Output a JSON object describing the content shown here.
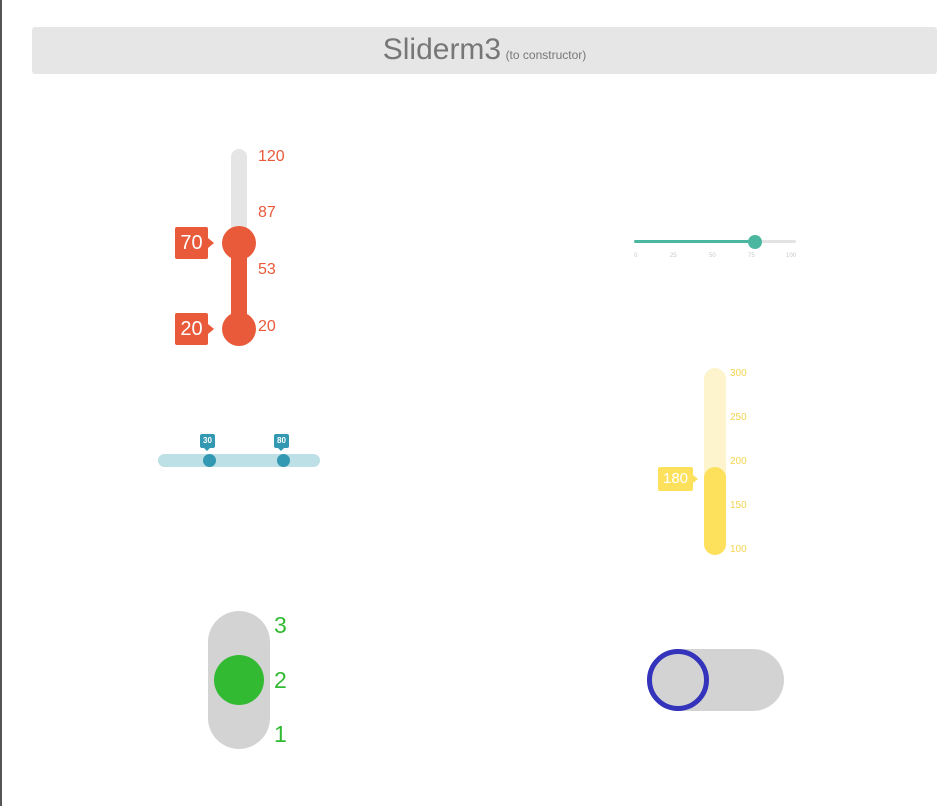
{
  "header": {
    "title": "Sliderm3",
    "subtitle": "(to constructor)"
  },
  "colors": {
    "red": "#e85a39",
    "teal": "#4cb7a0",
    "blue": "#3398b1",
    "yellow": "#fde05c",
    "green": "#33ba33",
    "navy": "#3333bb",
    "track_gray": "#d3d3d3"
  },
  "sliders": [
    {
      "orientation": "vertical",
      "type": "range",
      "color": "#e85a39",
      "min": 20,
      "max": 120,
      "values": {
        "upper": "70",
        "lower": "20"
      },
      "scale": [
        "120",
        "87",
        "53",
        "20"
      ]
    },
    {
      "orientation": "horizontal",
      "type": "single",
      "color": "#4cb7a0",
      "min": 0,
      "max": 100,
      "value": 75,
      "scale": [
        "0",
        "25",
        "50",
        "75",
        "100"
      ]
    },
    {
      "orientation": "horizontal",
      "type": "range",
      "color": "#3398b1",
      "values": {
        "from": "30",
        "to": "80"
      }
    },
    {
      "orientation": "vertical",
      "type": "single",
      "color": "#fde05c",
      "min": 100,
      "max": 300,
      "value": "180",
      "scale": [
        "300",
        "250",
        "200",
        "150",
        "100"
      ]
    },
    {
      "orientation": "vertical",
      "type": "steps",
      "color": "#33ba33",
      "value": 2,
      "scale": [
        "3",
        "2",
        "1"
      ]
    },
    {
      "orientation": "horizontal",
      "type": "toggle",
      "color": "#3333bb",
      "state": "off"
    }
  ]
}
